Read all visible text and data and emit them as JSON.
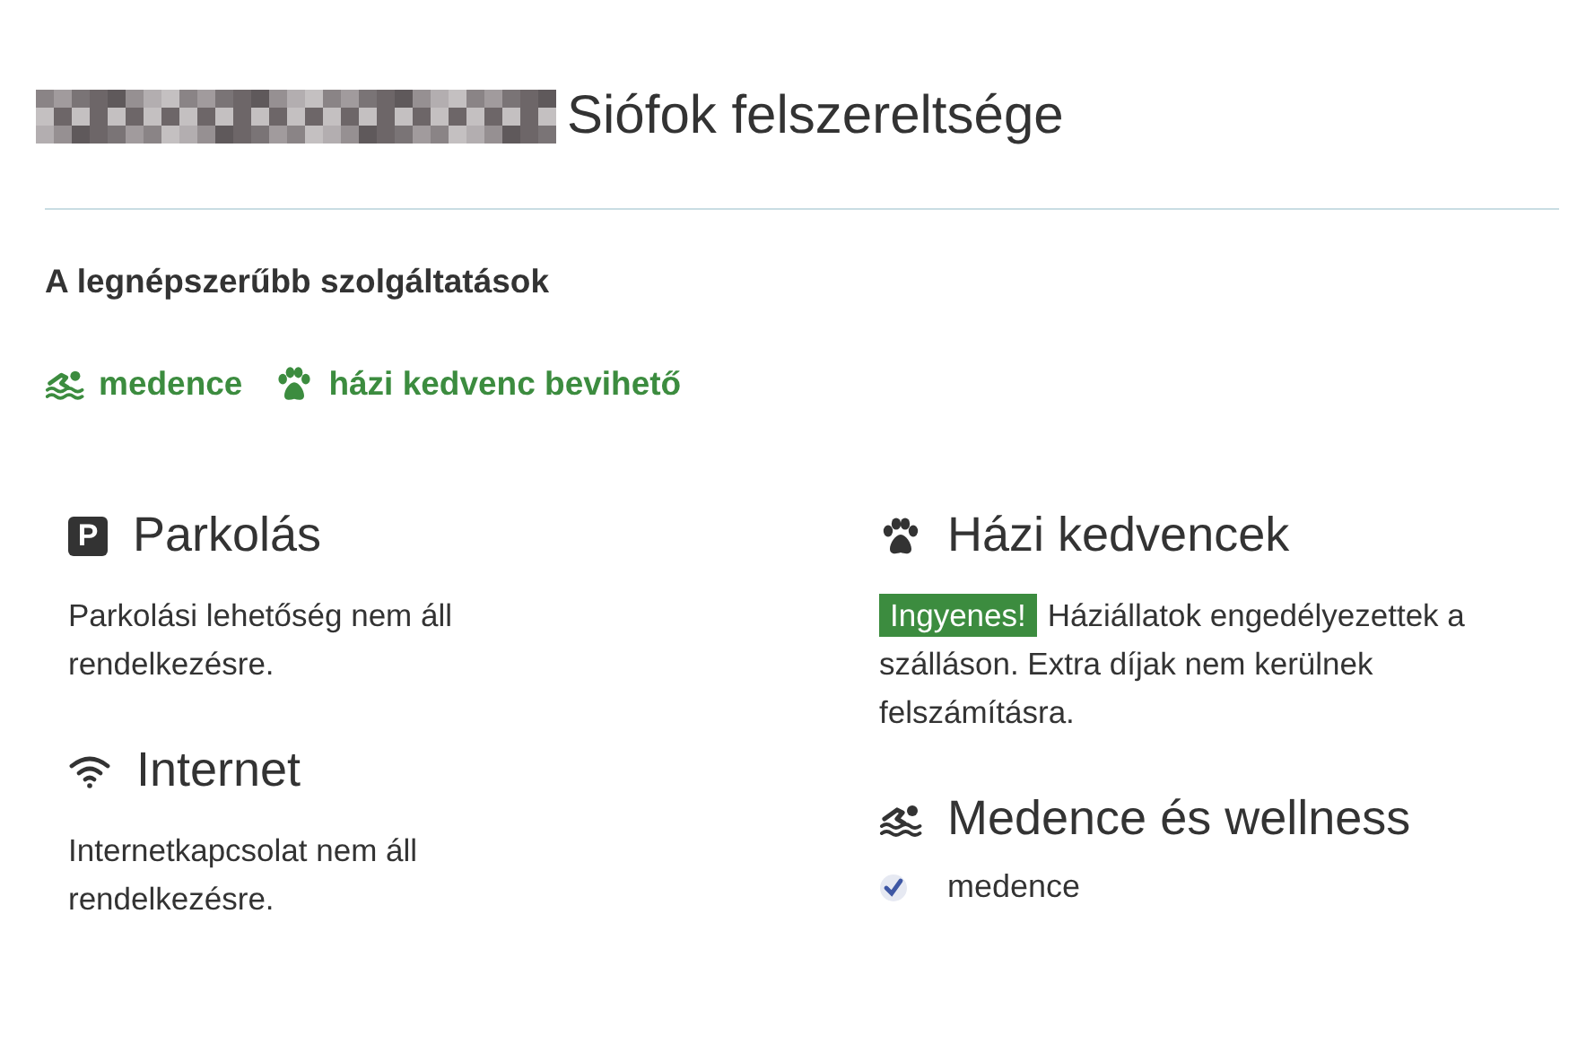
{
  "header": {
    "name_blurred": true,
    "title": "Siófok felszereltsége"
  },
  "popular": {
    "heading": "A legnépszerűbb szolgáltatások",
    "items": [
      {
        "kind": "swim",
        "label": "medence"
      },
      {
        "kind": "paw",
        "label": "házi kedvenc bevihető"
      }
    ]
  },
  "columns": [
    [
      {
        "kind": "parking",
        "icon_label": "P",
        "title": "Parkolás",
        "text": "Parkolási lehetőség nem áll rendelkezésre."
      },
      {
        "kind": "wifi",
        "title": "Internet",
        "text": "Internetkapcsolat nem áll rendelkezésre."
      }
    ],
    [
      {
        "kind": "paw",
        "title": "Házi kedvencek",
        "badge": "Ingyenes!",
        "text": "Háziállatok engedélyezettek a szálláson. Extra díjak nem kerülnek felszámításra."
      },
      {
        "kind": "swim",
        "title": "Medence és wellness",
        "checklist": [
          {
            "label": "medence",
            "checked": true
          }
        ]
      }
    ]
  ]
}
